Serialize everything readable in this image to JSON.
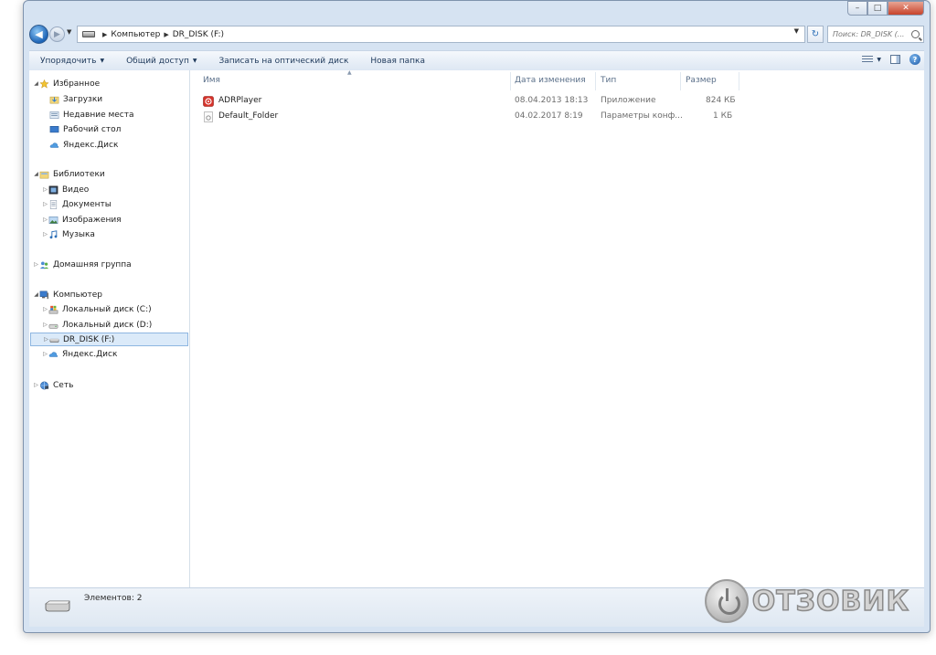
{
  "window": {
    "caption_buttons": [
      "–",
      "□",
      "✕"
    ]
  },
  "address": {
    "crumbs": [
      "Компьютер",
      "DR_DISK (F:)"
    ],
    "search_placeholder": "Поиск: DR_DISK (..."
  },
  "toolbar": {
    "organize": "Упорядочить",
    "share": "Общий доступ",
    "burn": "Записать на оптический диск",
    "new_folder": "Новая папка"
  },
  "nav": {
    "favorites": "Избранное",
    "downloads": "Загрузки",
    "recent": "Недавние места",
    "desktop": "Рабочий стол",
    "yadisk_fav": "Яндекс.Диск",
    "libraries": "Библиотеки",
    "video": "Видео",
    "docs": "Документы",
    "images": "Изображения",
    "music": "Музыка",
    "homegroup": "Домашняя группа",
    "computer": "Компьютер",
    "disk_c": "Локальный диск (C:)",
    "disk_d": "Локальный диск (D:)",
    "dr_disk": "DR_DISK (F:)",
    "yadisk_comp": "Яндекс.Диск",
    "network": "Сеть"
  },
  "columns": {
    "name": "Имя",
    "date": "Дата изменения",
    "type": "Тип",
    "size": "Размер"
  },
  "files": [
    {
      "name": "ADRPlayer",
      "date": "08.04.2013 18:13",
      "type": "Приложение",
      "size": "824 КБ"
    },
    {
      "name": "Default_Folder",
      "date": "04.02.2017 8:19",
      "type": "Параметры конф...",
      "size": "1 КБ"
    }
  ],
  "status": {
    "items": "Элементов: 2"
  },
  "watermark": {
    "text": "ОТЗОВИК"
  },
  "colors": {
    "accent": "#1d64b7",
    "frame": "#d6e3f2",
    "selection": "#dbeaf9",
    "app_icon": "#d7332b"
  },
  "icons": {
    "favorites": "star-icon",
    "libraries": "library-icon",
    "computer": "computer-icon",
    "network": "network-icon",
    "drive": "drive-icon"
  }
}
